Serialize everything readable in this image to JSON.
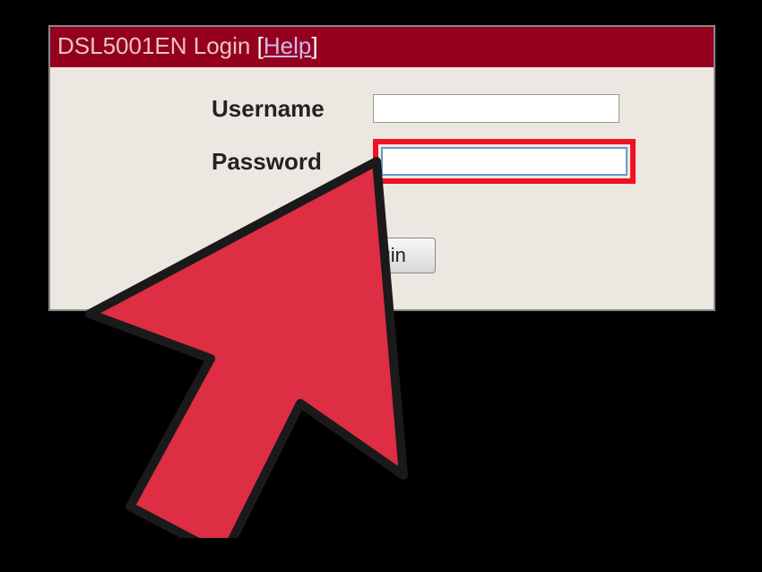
{
  "title": "DSL5001EN Login",
  "help_label": "Help",
  "form": {
    "username_label": "Username",
    "username_value": "",
    "password_label": "Password",
    "password_value": "",
    "login_button": "Login"
  }
}
